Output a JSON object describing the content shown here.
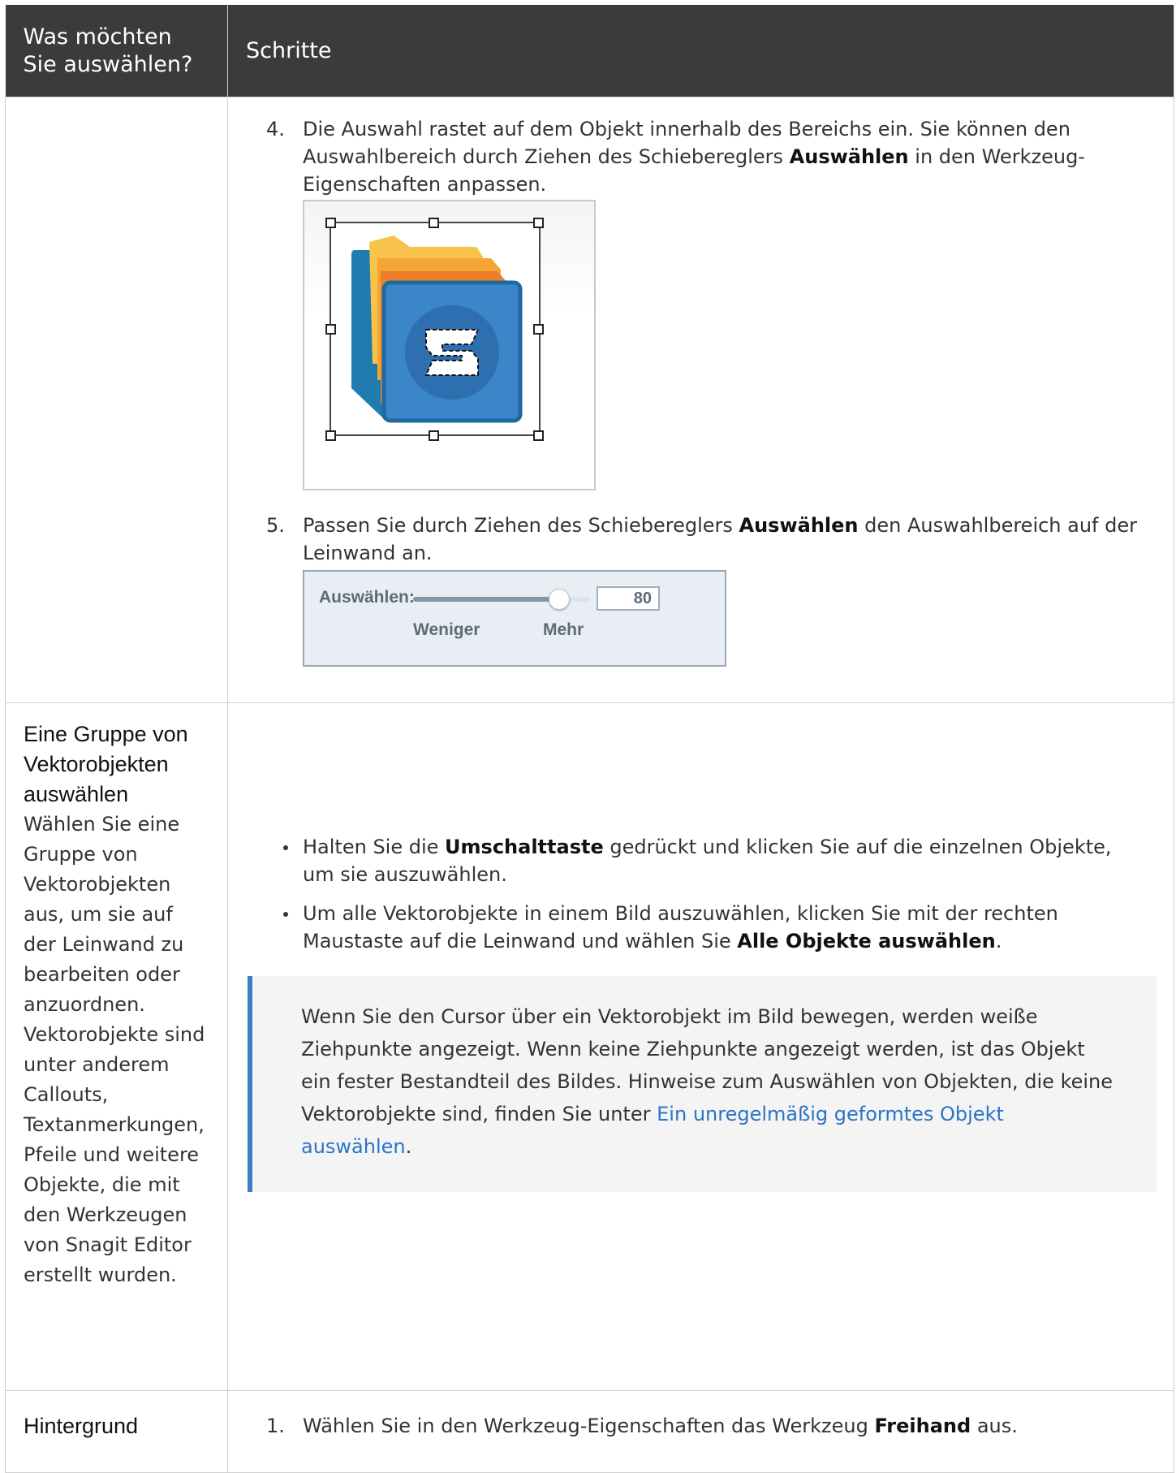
{
  "header": {
    "col1": "Was möchten Sie auswählen?",
    "col2": "Schritte"
  },
  "row1": {
    "step4": {
      "num": "4.",
      "text_a": "Die Auswahl rastet auf dem Objekt innerhalb des Bereichs ein. Sie können den Auswahlbereich durch Ziehen des Schiebereglers ",
      "bold": "Auswählen",
      "text_b": " in den Werkzeug-Eigenschaften anpassen."
    },
    "step5": {
      "num": "5.",
      "text_a": "Passen Sie durch Ziehen des Schiebereglers ",
      "bold": "Auswählen",
      "text_b": " den Auswahlbereich auf der Leinwand an."
    },
    "slider": {
      "label": "Auswählen:",
      "value": "80",
      "less": "Weniger",
      "more": "Mehr",
      "level": 0.82
    }
  },
  "row2": {
    "title": "Eine Gruppe von Vektorobjekten auswählen",
    "description": "Wählen Sie eine Gruppe von Vektorobjekten aus, um sie auf der Leinwand zu bearbeiten oder anzuordnen. Vektorobjekte sind unter anderem Callouts, Textanmerkungen, Pfeile und weitere Objekte, die mit den Werkzeugen von Snagit Editor erstellt wurden.",
    "bullet1": {
      "text_a": "Halten Sie die ",
      "bold": "Umschalttaste",
      "text_b": " gedrückt und klicken Sie auf die einzelnen Objekte, um sie auszuwählen."
    },
    "bullet2": {
      "text_a": "Um alle Vektorobjekte in einem Bild auszuwählen, klicken Sie mit der rechten Maustaste auf die Leinwand und wählen Sie ",
      "bold": "Alle Objekte auswählen",
      "text_b": "."
    },
    "note": {
      "text": "Wenn Sie den Cursor über ein Vektorobjekt im Bild bewegen, werden weiße Ziehpunkte angezeigt. Wenn keine Ziehpunkte angezeigt werden, ist das Objekt ein fester Bestandteil des Bildes. Hinweise zum Auswählen von Objekten, die keine Vektorobjekte sind, finden Sie unter ",
      "link": "Ein unregelmäßig geformtes Objekt auswählen",
      "end": "."
    }
  },
  "row3": {
    "title": "Hintergrund",
    "step1": {
      "num": "1.",
      "text_a": "Wählen Sie in den Werkzeug-Eigenschaften das Werkzeug ",
      "bold": "Freihand",
      "text_b": " aus."
    }
  },
  "colors": {
    "header_bg": "#3b3b3b",
    "link": "#2b74c7",
    "note_border": "#3b7fc4"
  }
}
